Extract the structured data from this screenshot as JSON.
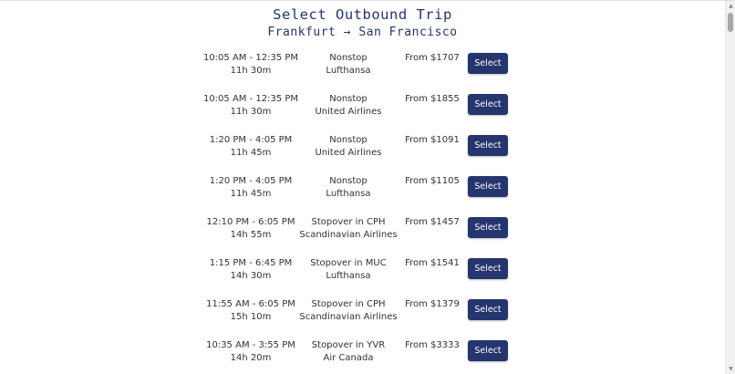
{
  "header": {
    "title": "Select Outbound Trip",
    "route": "Frankfurt → San Francisco"
  },
  "flights": [
    {
      "times": "10:05 AM - 12:35 PM",
      "duration": "11h 30m",
      "stops": "Nonstop",
      "airline": "Lufthansa",
      "price": "From $1707",
      "button": "Select"
    },
    {
      "times": "10:05 AM - 12:35 PM",
      "duration": "11h 30m",
      "stops": "Nonstop",
      "airline": "United Airlines",
      "price": "From $1855",
      "button": "Select"
    },
    {
      "times": "1:20 PM - 4:05 PM",
      "duration": "11h 45m",
      "stops": "Nonstop",
      "airline": "United Airlines",
      "price": "From $1091",
      "button": "Select"
    },
    {
      "times": "1:20 PM - 4:05 PM",
      "duration": "11h 45m",
      "stops": "Nonstop",
      "airline": "Lufthansa",
      "price": "From $1105",
      "button": "Select"
    },
    {
      "times": "12:10 PM - 6:05 PM",
      "duration": "14h 55m",
      "stops": "Stopover in CPH",
      "airline": "Scandinavian Airlines",
      "price": "From $1457",
      "button": "Select"
    },
    {
      "times": "1:15 PM - 6:45 PM",
      "duration": "14h 30m",
      "stops": "Stopover in MUC",
      "airline": "Lufthansa",
      "price": "From $1541",
      "button": "Select"
    },
    {
      "times": "11:55 AM - 6:05 PM",
      "duration": "15h 10m",
      "stops": "Stopover in CPH",
      "airline": "Scandinavian Airlines",
      "price": "From $1379",
      "button": "Select"
    },
    {
      "times": "10:35 AM - 3:55 PM",
      "duration": "14h 20m",
      "stops": "Stopover in YVR",
      "airline": "Air Canada",
      "price": "From $3333",
      "button": "Select"
    }
  ],
  "scrollbar": {
    "up_icon": "chevron-up-icon",
    "down_icon": "chevron-down-icon"
  },
  "colors": {
    "accent": "#25356e",
    "text": "#333333",
    "background": "#ffffff"
  }
}
